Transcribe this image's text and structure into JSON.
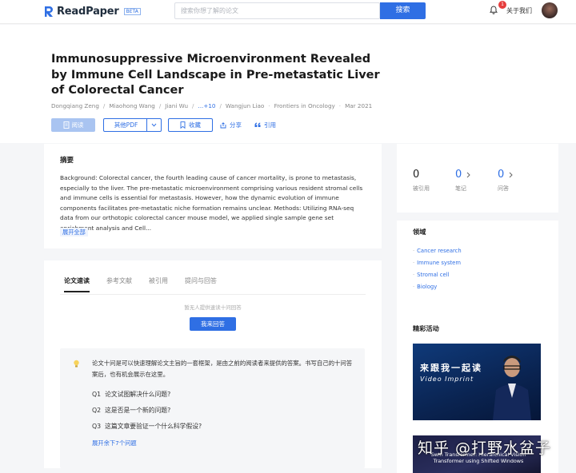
{
  "nav": {
    "logo_text": "ReadPaper",
    "beta": "BETA",
    "search_placeholder": "搜索你想了解的论文",
    "search_button": "搜索",
    "notification_count": "1",
    "about": "关于我们",
    "bell_icon": "bell-icon",
    "avatar_icon": "user-avatar"
  },
  "paper": {
    "title": "Immunosuppressive Microenvironment Revealed by Immune Cell Landscape in Pre-metastatic Liver of Colorectal Cancer",
    "authors": [
      "Dongqiang Zeng",
      "Miaohong Wang",
      "Jiani Wu",
      "...+10",
      "Wangjun Liao"
    ],
    "journal": "Frontiers in Oncology",
    "date": "Mar 2021"
  },
  "actions": {
    "read": "阅读",
    "other_pdf": "其他PDF",
    "favorite": "收藏",
    "share": "分享",
    "cite": "引用"
  },
  "abstract": {
    "heading": "摘要",
    "text": "Background: Colorectal cancer, the fourth leading cause of cancer mortality, is prone to metastasis, especially to the liver. The pre-metastatic microenvironment comprising various resident stromal cells and immune cells is essential for metastasis. However, how the dynamic evolution of immune components facilitates pre-metastatic niche formation remains unclear. Methods: Utilizing RNA-seq data from our orthotopic colorectal cancer mouse model, we applied single sample gene set enrichment analysis and Cell...",
    "expand": "展开全部"
  },
  "tabs": {
    "items": [
      "论文速读",
      "参考文献",
      "被引用",
      "提问与回答"
    ],
    "empty_hint": "暂无人提供速读十问回答",
    "answer_button": "我来回答",
    "intro": "论文十问是可以快速理解论文主旨的一套框架，是由之前的阅读者来提供的答案。书写自己的十问答案后，也有机会展示在这里。",
    "questions": [
      {
        "n": "Q1",
        "text": "论文试图解决什么问题?"
      },
      {
        "n": "Q2",
        "text": "这是否是一个新的问题?"
      },
      {
        "n": "Q3",
        "text": "这篇文章要验证一个什么科学假设?"
      }
    ],
    "more_questions": "展开余下7个问题"
  },
  "stats": [
    {
      "value": "0",
      "label": "被引用"
    },
    {
      "value": "0",
      "label": "笔记"
    },
    {
      "value": "0",
      "label": "问答"
    }
  ],
  "fields": {
    "heading": "领域",
    "items": [
      "Cancer research",
      "Immune system",
      "Stromal cell",
      "Biology"
    ]
  },
  "activities": {
    "heading": "精彩活动",
    "promo1_title": "来跟我一起读",
    "promo1_sub": "Video Imprint",
    "promo2_text": "Swin Transformer: Hierarchical Vision Transformer using Shifted Windows"
  },
  "watermark": "知乎 @打野水盆子",
  "colors": {
    "accent": "#2f6fe4",
    "badge": "#e63d3d"
  }
}
